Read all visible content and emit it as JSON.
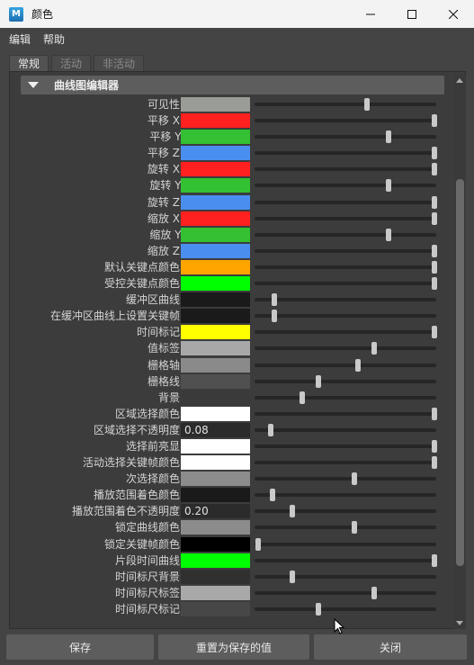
{
  "window": {
    "title": "颜色",
    "icon_letter": "M",
    "controls": [
      "minimize-icon",
      "maximize-icon",
      "close-icon"
    ]
  },
  "menu": [
    "编辑",
    "帮助"
  ],
  "tabs": [
    {
      "label": "常规",
      "active": true
    },
    {
      "label": "活动",
      "active": false
    },
    {
      "label": "非活动",
      "active": false
    }
  ],
  "section": {
    "label": "曲线图编辑器",
    "icon": "collapse-triangle-icon"
  },
  "rows": [
    {
      "label": "可见性:",
      "color": "#9a9d97",
      "slider": 0.62
    },
    {
      "label": "平移 X:",
      "color": "#ff2020",
      "slider": 0.99
    },
    {
      "label": "平移 Y:",
      "color": "#33c033",
      "slider": 0.74
    },
    {
      "label": "平移 Z:",
      "color": "#4a8ef0",
      "slider": 0.99
    },
    {
      "label": "旋转 X:",
      "color": "#ff2020",
      "slider": 0.99
    },
    {
      "label": "旋转 Y:",
      "color": "#33c033",
      "slider": 0.74
    },
    {
      "label": "旋转 Z:",
      "color": "#4a8ef0",
      "slider": 0.99
    },
    {
      "label": "缩放 X:",
      "color": "#ff2020",
      "slider": 0.99
    },
    {
      "label": "缩放 Y:",
      "color": "#33c033",
      "slider": 0.74
    },
    {
      "label": "缩放 Z:",
      "color": "#4a8ef0",
      "slider": 0.99
    },
    {
      "label": "默认关键点颜色:",
      "color": "#ffa500",
      "slider": 0.99
    },
    {
      "label": "受控关键点颜色:",
      "color": "#00ff00",
      "slider": 0.99
    },
    {
      "label": "缓冲区曲线:",
      "color": "#1a1a1a",
      "slider": 0.11
    },
    {
      "label": "在缓冲区曲线上设置关键帧:",
      "color": "#1a1a1a",
      "slider": 0.11
    },
    {
      "label": "时间标记:",
      "color": "#ffff00",
      "slider": 0.99
    },
    {
      "label": "值标签:",
      "color": "#a8a8a8",
      "slider": 0.66
    },
    {
      "label": "栅格轴:",
      "color": "#8a8a8a",
      "slider": 0.57
    },
    {
      "label": "栅格线:",
      "color": "#505050",
      "slider": 0.35
    },
    {
      "label": "背景:",
      "color": "#3a3a3a",
      "slider": 0.26
    },
    {
      "label": "区域选择颜色:",
      "color": "#ffffff",
      "slider": 0.99
    },
    {
      "label": "区域选择不透明度:",
      "value": "0.08",
      "slider": 0.09
    },
    {
      "label": "选择前亮显:",
      "color": "#ffffff",
      "slider": 0.99
    },
    {
      "label": "活动选择关键帧颜色:",
      "color": "#ffffff",
      "slider": 0.99
    },
    {
      "label": "次选择颜色:",
      "color": "#8c8c8c",
      "slider": 0.55
    },
    {
      "label": "播放范围着色颜色:",
      "color": "#1a1a1a",
      "slider": 0.1
    },
    {
      "label": "播放范围着色不透明度:",
      "value": "0.20",
      "slider": 0.21
    },
    {
      "label": "锁定曲线颜色:",
      "color": "#8c8c8c",
      "slider": 0.55
    },
    {
      "label": "锁定关键帧颜色:",
      "color": "#000000",
      "slider": 0.02
    },
    {
      "label": "片段时间曲线:",
      "color": "#00ff00",
      "slider": 0.99
    },
    {
      "label": "时间标尺背景:",
      "color": "#303030",
      "slider": 0.21
    },
    {
      "label": "时间标尺标签:",
      "color": "#a8a8a8",
      "slider": 0.66
    },
    {
      "label": "时间标尺标记:",
      "color": "#474747",
      "slider": 0.35
    }
  ],
  "buttons": {
    "save": "保存",
    "reset": "重置为保存的值",
    "close": "关闭"
  },
  "colors": {
    "titlebar_bg": "#f3f3f3",
    "panel_bg": "#3c3c3c",
    "header_bg": "#5d5d5d",
    "button_bg": "#5d5d5d"
  }
}
